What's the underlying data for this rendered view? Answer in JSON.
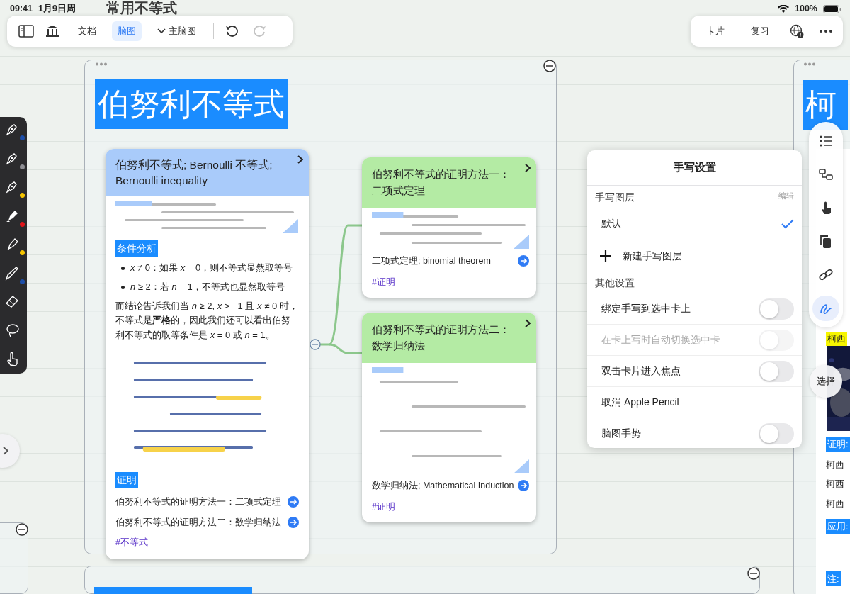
{
  "status_bar": {
    "time": "09:41",
    "date": "1月9日周",
    "battery": "100%"
  },
  "canvas_title": "常用不等式",
  "toolbar": {
    "tabs": [
      {
        "label": "文档",
        "selected": false
      },
      {
        "label": "脑图",
        "selected": true
      }
    ],
    "map_selector": "主脑图",
    "redo_disabled": true,
    "right_buttons": [
      "卡片",
      "复习"
    ]
  },
  "pen_tools": [
    {
      "kind": "pen",
      "color": "#1d4ea8"
    },
    {
      "kind": "pen",
      "color": "#8e8e93"
    },
    {
      "kind": "pen",
      "color": "#f5c400"
    },
    {
      "kind": "marker",
      "color": "#e0151b"
    },
    {
      "kind": "highlighter",
      "color": "#f5c400"
    },
    {
      "kind": "pencil",
      "color": "#1d4ea8"
    },
    {
      "kind": "eraser"
    },
    {
      "kind": "lasso"
    },
    {
      "kind": "hand"
    }
  ],
  "frame": {
    "title": "伯努利不等式"
  },
  "main_card": {
    "title": "伯努利不等式; Bernoulli 不等式; Bernoulli inequality",
    "blocks": [
      {
        "kind": "picture"
      },
      {
        "kind": "heading",
        "text": "条件分析"
      },
      {
        "kind": "bullets",
        "items": [
          "*x* ≠ 0：如果 *x* = 0，则不等式显然取等号",
          "*n* ≥ 2：若 *n* = 1，不等式也显然取等号"
        ]
      },
      {
        "kind": "paragraph",
        "text": "而结论告诉我们当 *n* ≥ 2, *x* > −1 且 *x* ≠ 0 时，不等式是**严格**的，因此我们还可以看出伯努利不等式的取等条件是 *x* = 0 或 *n* = 1。"
      },
      {
        "kind": "picture"
      },
      {
        "kind": "heading",
        "text": "证明"
      },
      {
        "kind": "link",
        "text": "伯努利不等式的证明方法一：二项式定理"
      },
      {
        "kind": "link",
        "text": "伯努利不等式的证明方法二：数学归纳法"
      },
      {
        "kind": "tag",
        "text": "#不等式"
      }
    ]
  },
  "proof_cards": [
    {
      "title": "伯努利不等式的证明方法一：二项式定理",
      "subtitle": "二项式定理; binomial theorem",
      "tag": "#证明"
    },
    {
      "title": "伯努利不等式的证明方法二：数学归纳法",
      "subtitle": "数学归纳法; Mathematical Induction",
      "tag": "#证明"
    }
  ],
  "popup": {
    "title": "手写设置",
    "layers_label": "手写图层",
    "edit": "编辑",
    "layers": [
      {
        "name": "默认",
        "selected": true
      }
    ],
    "new_layer": "新建手写图层",
    "other_label": "其他设置",
    "settings": [
      {
        "kind": "toggle",
        "label": "绑定手写到选中卡上",
        "on": false,
        "disabled": false
      },
      {
        "kind": "toggle",
        "label": "在卡上写时自动切换选中卡",
        "on": false,
        "disabled": true
      },
      {
        "kind": "toggle",
        "label": "双击卡片进入焦点",
        "on": false,
        "disabled": false
      },
      {
        "kind": "action",
        "label": "取消 Apple Pencil"
      },
      {
        "kind": "toggle",
        "label": "脑图手势",
        "on": false,
        "disabled": false
      }
    ]
  },
  "right_card": {
    "title": "柯",
    "highlight": "柯西",
    "rows": [
      {
        "kind": "heading",
        "text": "证明:"
      },
      {
        "kind": "item",
        "text": "柯西"
      },
      {
        "kind": "item",
        "text": "柯西"
      },
      {
        "kind": "item",
        "text": "柯西"
      },
      {
        "kind": "heading",
        "text": "应用:"
      },
      {
        "kind": "heading",
        "text": "注:"
      }
    ]
  },
  "side_tools": {
    "select_label": "选择"
  }
}
